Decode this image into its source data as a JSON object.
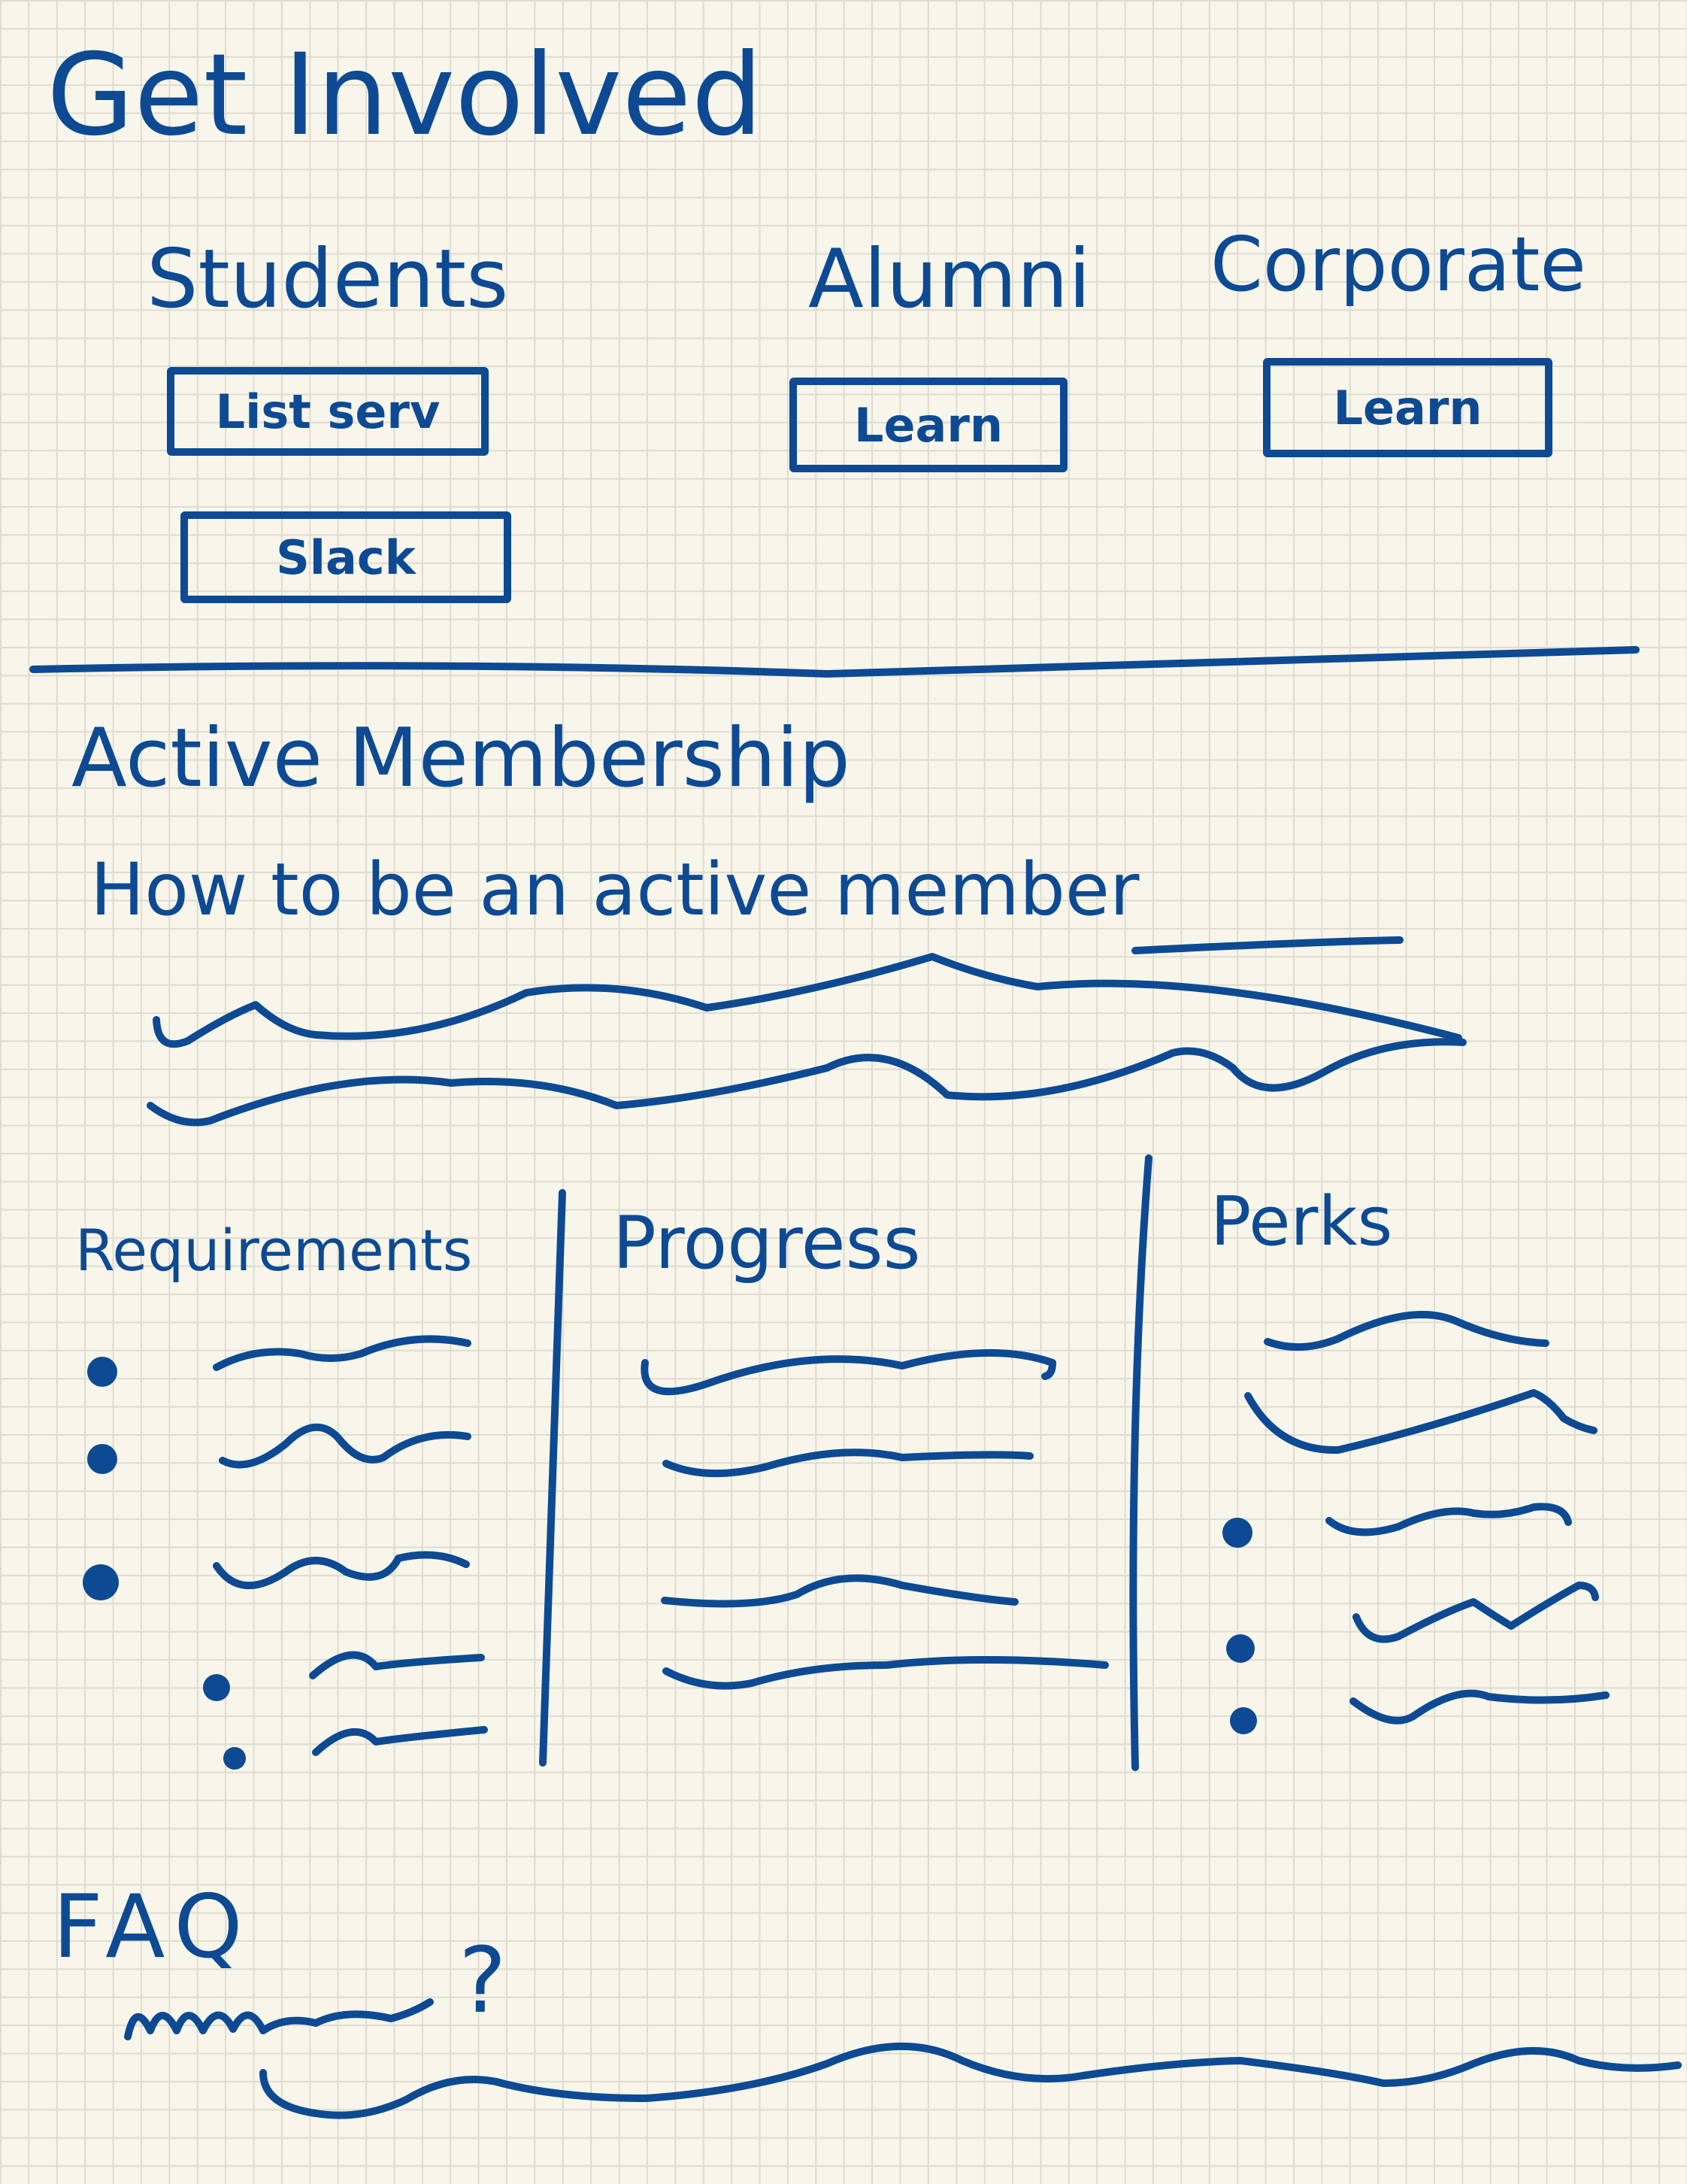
{
  "header": {
    "title": "Get Involved"
  },
  "audiences": [
    {
      "heading": "Students",
      "buttons": [
        "List serv",
        "Slack"
      ]
    },
    {
      "heading": "Alumni",
      "buttons": [
        "Learn"
      ]
    },
    {
      "heading": "Corporate",
      "buttons": [
        "Learn"
      ]
    }
  ],
  "membership": {
    "title": "Active Membership",
    "subtitle": "How to be an active member",
    "columns": [
      {
        "heading": "Requirements"
      },
      {
        "heading": "Progress"
      },
      {
        "heading": "Perks"
      }
    ]
  },
  "faq": {
    "title": "FAQ",
    "question_mark": "?"
  },
  "colors": {
    "ink": "#0d4a93",
    "paper": "#f8f6ea",
    "grid": "#dedcd0"
  }
}
